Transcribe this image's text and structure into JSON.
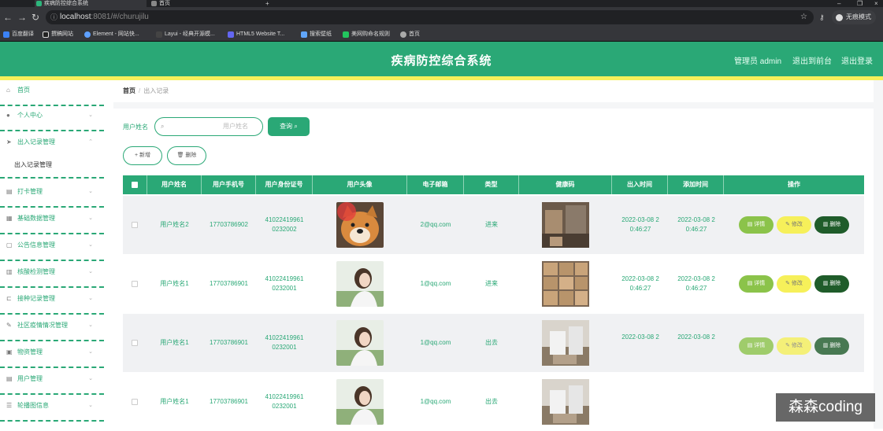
{
  "browser": {
    "tabs": [
      {
        "label": "疾病防控综合系统"
      },
      {
        "label": "首页"
      }
    ],
    "url_host": "localhost",
    "url_path": ":8081/#/churujilu",
    "incognito": "无痕模式",
    "bookmarks": [
      "百度翻译",
      "撰稿网站",
      "Element - 网站快...",
      "Layui - 经典开源模...",
      "HTML5 Website T...",
      "搜索壁纸",
      "美网购命名规则",
      "首页"
    ]
  },
  "header": {
    "title": "疾病防控综合系统",
    "admin": "管理员 admin",
    "backstage": "退出到前台",
    "logout": "退出登录"
  },
  "sidebar": {
    "items": [
      {
        "label": "首页",
        "icon": "home-icon"
      },
      {
        "label": "个人中心",
        "icon": "user-icon"
      },
      {
        "label": "出入记录管理",
        "icon": "send-icon"
      },
      {
        "label": "打卡管理",
        "icon": "list-icon"
      },
      {
        "label": "基础数据管理",
        "icon": "grid-icon"
      },
      {
        "label": "公告信息管理",
        "icon": "doc-icon"
      },
      {
        "label": "核酸检测管理",
        "icon": "chart-icon"
      },
      {
        "label": "接种记录管理",
        "icon": "box-icon"
      },
      {
        "label": "社区疫情情况管理",
        "icon": "edit-icon"
      },
      {
        "label": "物资管理",
        "icon": "cart-icon"
      },
      {
        "label": "用户管理",
        "icon": "users-icon"
      },
      {
        "label": "轮播图信息",
        "icon": "image-icon"
      }
    ],
    "sub": "出入记录管理"
  },
  "breadcrumb": {
    "home": "首页",
    "sep": "/",
    "current": "出入记录"
  },
  "search": {
    "label": "用户姓名",
    "placeholder": "用户姓名",
    "query": "查询"
  },
  "actions": {
    "add": "+ 新增",
    "delete": "删除"
  },
  "table": {
    "headers": [
      "用户姓名",
      "用户手机号",
      "用户身份证号",
      "用户头像",
      "电子邮箱",
      "类型",
      "健康码",
      "出入时间",
      "添加时间",
      "操作"
    ],
    "rows": [
      {
        "name": "用户姓名2",
        "phone": "17703786902",
        "idcard": "41022419961 0232002",
        "email": "2@qq.com",
        "type": "进来",
        "out_time": "2022-03-08 2 0:46:27",
        "add_time": "2022-03-08 2 0:46:27"
      },
      {
        "name": "用户姓名1",
        "phone": "17703786901",
        "idcard": "41022419961 0232001",
        "email": "1@qq.com",
        "type": "进来",
        "out_time": "2022-03-08 2 0:46:27",
        "add_time": "2022-03-08 2 0:46:27"
      },
      {
        "name": "用户姓名1",
        "phone": "17703786901",
        "idcard": "41022419961 0232001",
        "email": "1@qq.com",
        "type": "出去",
        "out_time": "2022-03-08 2",
        "add_time": "2022-03-08 2"
      },
      {
        "name": "用户姓名1",
        "phone": "17703786901",
        "idcard": "41022419961 0232001",
        "email": "1@qq.com",
        "type": "出去",
        "out_time": "",
        "add_time": ""
      }
    ],
    "row_actions": {
      "detail": "详情",
      "edit": "修改",
      "delete": "删除"
    }
  },
  "watermark": "森森coding",
  "colors": {
    "primary": "#2aa876",
    "accent_yellow": "#f6f05a",
    "detail_green": "#8bc34a",
    "delete_dark": "#1f5c2a"
  }
}
